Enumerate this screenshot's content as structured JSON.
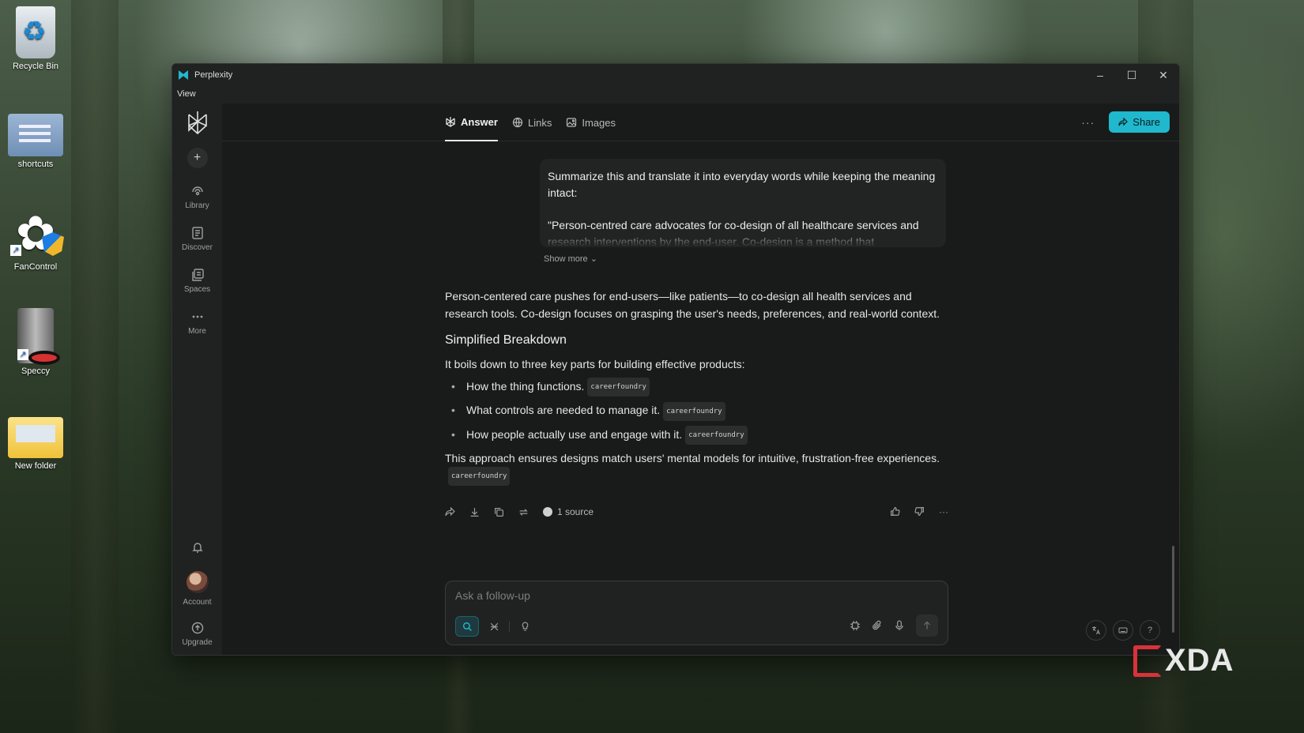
{
  "desktop": {
    "icons": [
      {
        "label": "Recycle Bin",
        "icon": "recycle-bin-icon"
      },
      {
        "label": "shortcuts",
        "icon": "folder-icon"
      },
      {
        "label": "FanControl",
        "icon": "fancontrol-icon"
      },
      {
        "label": "Speccy",
        "icon": "speccy-icon"
      },
      {
        "label": "New folder",
        "icon": "folder-icon"
      }
    ],
    "watermark": "XDA"
  },
  "window": {
    "title": "Perplexity",
    "menu": [
      "View"
    ],
    "controls": {
      "minimize": "–",
      "maximize": "☐",
      "close": "✕"
    }
  },
  "sidebar": {
    "new_label": "+",
    "items": [
      {
        "label": "Library",
        "icon": "library-icon"
      },
      {
        "label": "Discover",
        "icon": "discover-icon"
      },
      {
        "label": "Spaces",
        "icon": "spaces-icon"
      },
      {
        "label": "More",
        "icon": "more-icon"
      }
    ],
    "account_label": "Account",
    "upgrade_label": "Upgrade"
  },
  "tabs": [
    {
      "label": "Answer",
      "icon": "perplexity-icon",
      "active": true
    },
    {
      "label": "Links",
      "icon": "globe-icon",
      "active": false
    },
    {
      "label": "Images",
      "icon": "image-icon",
      "active": false
    }
  ],
  "toolbar": {
    "more_label": "···",
    "share_label": "Share"
  },
  "query": {
    "line1": "Summarize this and translate it into everyday words while keeping the meaning intact:",
    "line2": "\"Person-centred care advocates for co-design of all healthcare services and research interventions by the end-user. Co-design is a method that",
    "show_more": "Show more"
  },
  "answer": {
    "intro": "Person-centered care pushes for end-users—like patients—to co-design all health services and research tools. Co-design focuses on grasping the user's needs, preferences, and real-world context.",
    "heading": "Simplified Breakdown",
    "lead": "It boils down to three key parts for building effective products:",
    "bullets": [
      {
        "text": "How the thing functions.",
        "cite": "careerfoundry"
      },
      {
        "text": "What controls are needed to manage it.",
        "cite": "careerfoundry"
      },
      {
        "text": "How people actually use and engage with it.",
        "cite": "careerfoundry"
      }
    ],
    "closing": "This approach ensures designs match users' mental models for intuitive, frustration-free experiences.",
    "closing_cite": "careerfoundry",
    "sources_label": "1 source",
    "more_label": "···"
  },
  "followup": {
    "placeholder": "Ask a follow-up"
  },
  "corner": {
    "help_label": "?"
  },
  "colors": {
    "accent": "#20b8cd",
    "background": "#191a1a",
    "sidebar": "#202121"
  }
}
